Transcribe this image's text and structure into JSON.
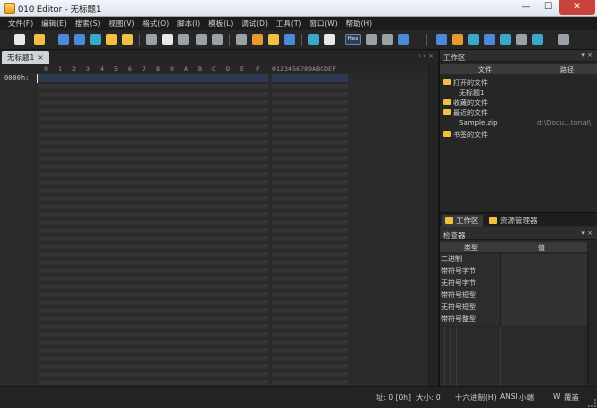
{
  "window": {
    "title": "010 Editor - 无标题1",
    "controls": [
      "—",
      "☐",
      "✕"
    ]
  },
  "menu": [
    "文件(F)",
    "编辑(E)",
    "搜索(S)",
    "视图(V)",
    "格式(O)",
    "脚本(I)",
    "模板(L)",
    "调试(D)",
    "工具(T)",
    "窗口(W)",
    "帮助(H)"
  ],
  "toolbar": {
    "hex_label": "Hex"
  },
  "editor": {
    "tab_label": "无标题1",
    "tab_close": "×",
    "tab_nav": "‹ › ×",
    "col_headers": [
      "0",
      "1",
      "2",
      "3",
      "4",
      "5",
      "6",
      "7",
      "8",
      "9",
      "A",
      "B",
      "C",
      "D",
      "E",
      "F"
    ],
    "ascii_header": "0123456789ABCDEF",
    "row_label": "0000h:"
  },
  "workspace": {
    "title": "工作区",
    "controls": "▾ ×",
    "columns": {
      "file": "文件",
      "path": "路径"
    },
    "rows": [
      {
        "label": "打开的文件",
        "path": "",
        "folder": true,
        "indent": 0
      },
      {
        "label": "无标题1",
        "path": "",
        "folder": false,
        "indent": 1
      },
      {
        "label": "收藏的文件",
        "path": "",
        "folder": true,
        "indent": 0
      },
      {
        "label": "最近的文件",
        "path": "",
        "folder": true,
        "indent": 0
      },
      {
        "label": "Sample.zip",
        "path": "d:\\Docu...torial\\",
        "folder": false,
        "indent": 1
      },
      {
        "label": "书签的文件",
        "path": "",
        "folder": true,
        "indent": 0
      }
    ]
  },
  "pane_tabs": [
    "工作区",
    "资源管理器"
  ],
  "inspector": {
    "title": "检查器",
    "controls": "▾ ×",
    "columns": {
      "type": "类型",
      "value": "值"
    },
    "rows": [
      "二进制",
      "带符号字节",
      "无符号字节",
      "带符号短型",
      "无符号短型",
      "带符号整型"
    ]
  },
  "status": {
    "address": "址: 0 [0h]",
    "size": "大小: 0",
    "mode": "十六进制(H)",
    "encoding": "ANSI",
    "endian": "小端",
    "write": "W",
    "overwrite": "覆盖"
  }
}
